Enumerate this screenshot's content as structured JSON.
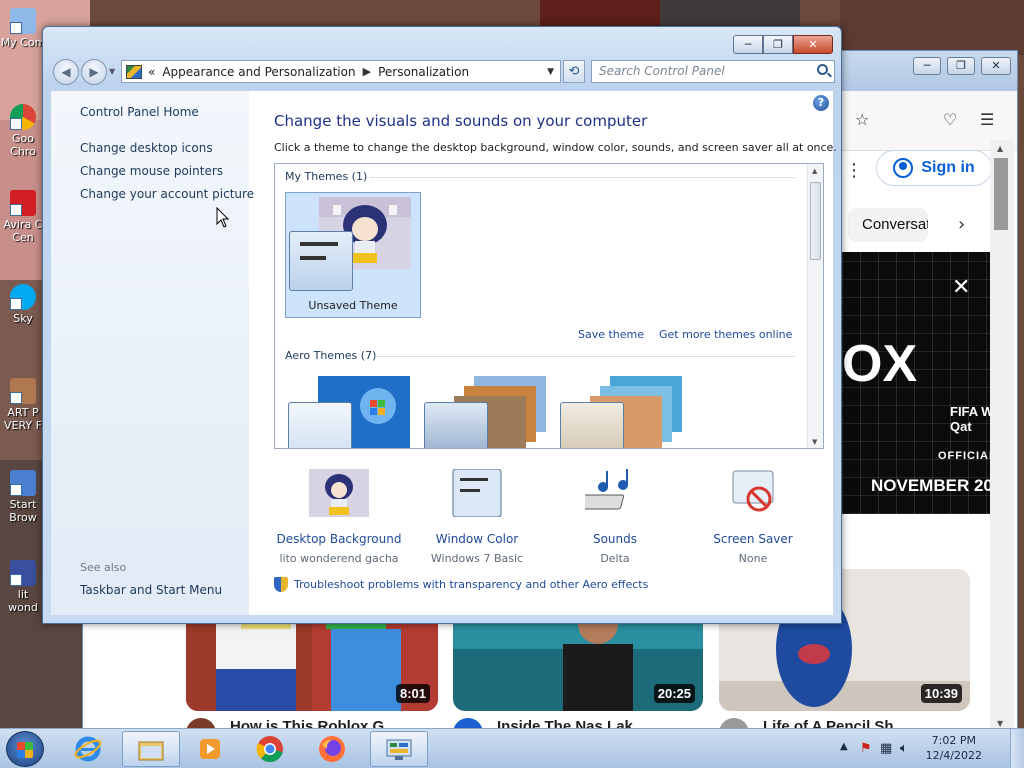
{
  "desktop": {
    "icons": [
      {
        "label_line1": "My Com",
        "label_line2": ""
      },
      {
        "label_line1": "Goo",
        "label_line2": "Chro"
      },
      {
        "label_line1": "Avira C",
        "label_line2": "Cen"
      },
      {
        "label_line1": "Sky",
        "label_line2": ""
      },
      {
        "label_line1": "ART P",
        "label_line2": "VERY F"
      },
      {
        "label_line1": "Start",
        "label_line2": "Brow"
      },
      {
        "label_line1": "lit",
        "label_line2": "wond"
      }
    ]
  },
  "browser": {
    "sign_in_label": "Sign in",
    "chip_label": "Conversat",
    "ad": {
      "big_text": "OX",
      "fifa_text": "FIFA W",
      "fifa_text2": "Qat",
      "official_text": "OFFICIAL",
      "date_text": "NOVEMBER 20"
    },
    "video_durations": [
      "8:01",
      "20:25",
      "10:39"
    ],
    "video_titles": [
      "How is This Roblox G",
      "Inside The Nas Lak",
      "Life of A Pencil Sh"
    ]
  },
  "control_panel": {
    "breadcrumb": {
      "root_chevron": "«",
      "items": [
        "Appearance and Personalization",
        "Personalization"
      ]
    },
    "search_placeholder": "Search Control Panel",
    "left_pane": {
      "links": [
        "Control Panel Home",
        "Change desktop icons",
        "Change mouse pointers",
        "Change your account picture"
      ],
      "see_also_label": "See also",
      "see_also_links": [
        "Taskbar and Start Menu"
      ]
    },
    "heading": "Change the visuals and sounds on your computer",
    "subtext": "Click a theme to change the desktop background, window color, sounds, and screen saver all at once.",
    "my_themes_label": "My Themes (1)",
    "selected_theme_label": "Unsaved Theme",
    "save_theme_link": "Save theme",
    "get_more_link": "Get more themes online",
    "aero_themes_label": "Aero Themes (7)",
    "bottom_items": [
      {
        "name": "Desktop Background",
        "value": "lito wonderend gacha",
        "icon": "desktop-background-thumbnail"
      },
      {
        "name": "Window Color",
        "value": "Windows 7 Basic",
        "icon": "window-color-icon"
      },
      {
        "name": "Sounds",
        "value": "Delta",
        "icon": "sounds-icon"
      },
      {
        "name": "Screen Saver",
        "value": "None",
        "icon": "screen-saver-icon"
      }
    ],
    "troubleshoot_link": "Troubleshoot problems with transparency and other Aero effects"
  },
  "taskbar": {
    "time": "7:02 PM",
    "date": "12/4/2022"
  },
  "colors": {
    "link_blue": "#1e4a9b",
    "heading_blue": "#1e3287",
    "selection_bg": "#cde3fb",
    "taskbar": "#b9cfe9"
  }
}
